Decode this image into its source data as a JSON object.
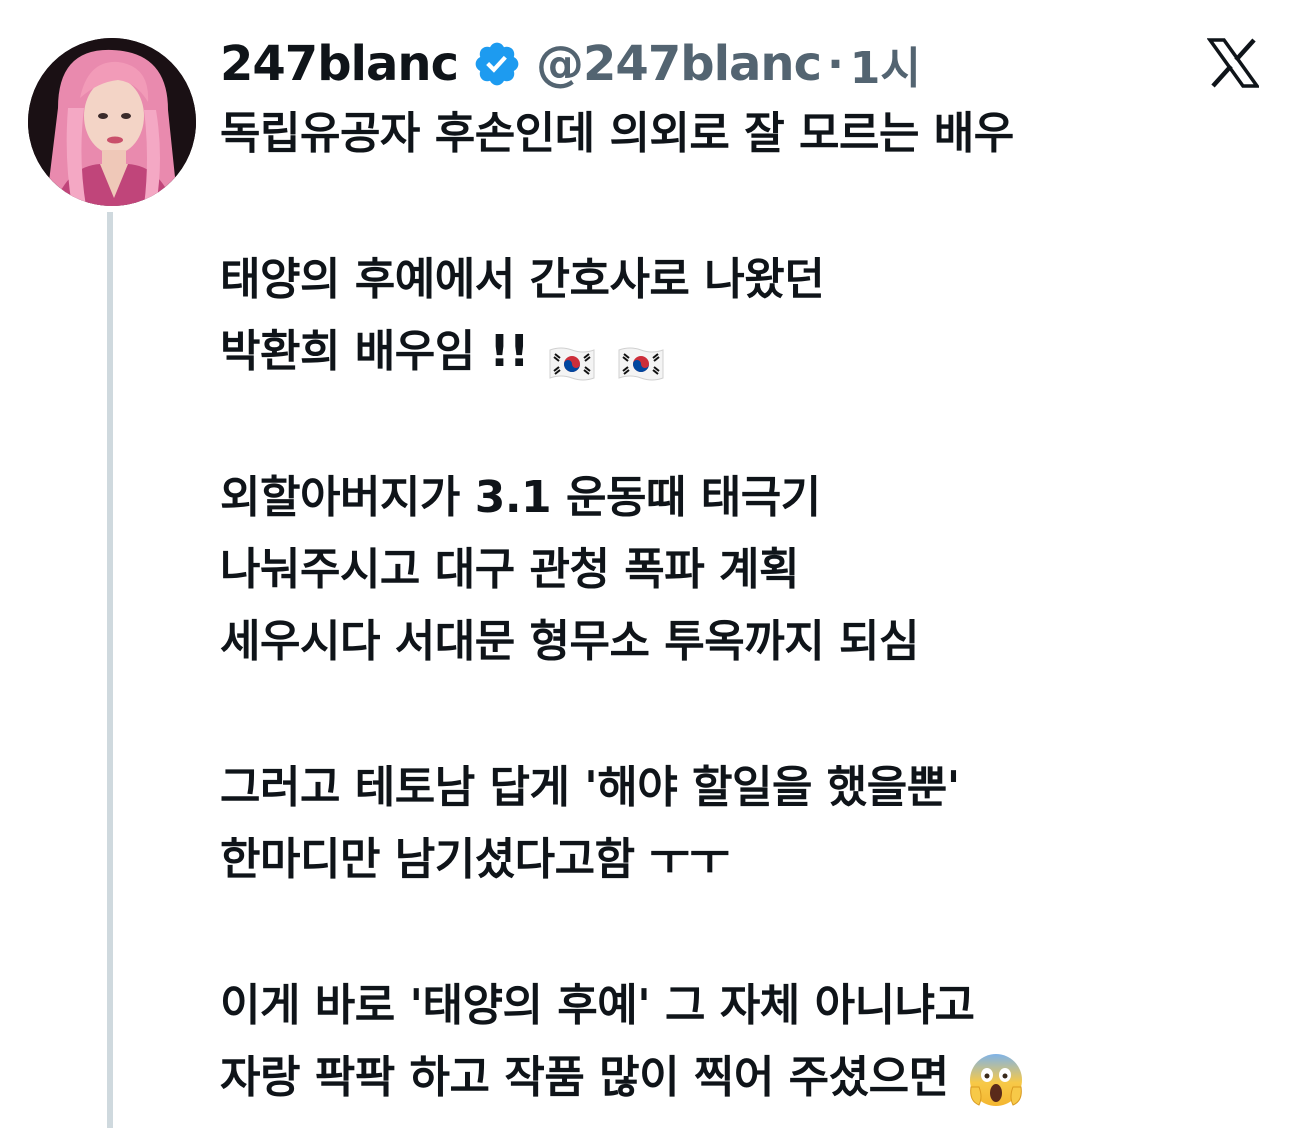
{
  "author": {
    "display_name": "247blanc",
    "handle": "@247blanc",
    "separator": "·",
    "time": "1시",
    "verified": true,
    "avatar_icon": "profile-photo-pink-hair",
    "verified_icon": "verified-badge-icon",
    "brand_icon": "x-logo-icon"
  },
  "tweet": {
    "line1": "독립유공자 후손인데 의외로 잘 모르는 배우",
    "line2": "태양의 후예에서 간호사로 나왔던",
    "line3": "박환희 배우임 !!",
    "line4": "외할아버지가 3.1 운동때 태극기",
    "line5": "나눠주시고 대구 관청 폭파 계획",
    "line6": "세우시다 서대문 형무소 투옥까지 되심",
    "line7": "그러고 테토남 답게 '해야 할일을 했을뿐'",
    "line8": "한마디만 남기셨다고함 ㅜㅜ",
    "line9": "이게 바로 '태양의 후예' 그 자체 아니냐고",
    "line10": "자랑 팍팍 하고 작품 많이 찍어 주셨으면"
  },
  "emoji": {
    "flag": "south-korea-flag-icon",
    "scream": "face-screaming-in-fear-icon"
  },
  "colors": {
    "text": "#0f1419",
    "secondary": "#536471",
    "verified_blue": "#1d9bf0",
    "thread_line": "#cfd9de",
    "avatar_hair": "#f29bb8"
  }
}
